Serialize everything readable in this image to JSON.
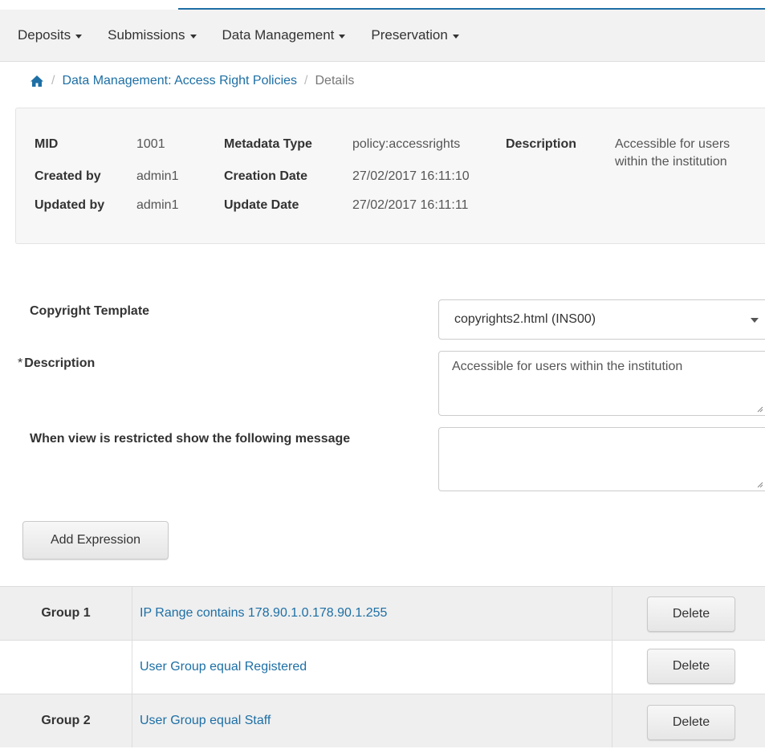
{
  "nav": {
    "items": [
      {
        "label": "Deposits"
      },
      {
        "label": "Submissions"
      },
      {
        "label": "Data Management"
      },
      {
        "label": "Preservation"
      }
    ]
  },
  "breadcrumb": {
    "home_icon": "home-icon",
    "separator": "/",
    "link": "Data Management: Access Right Policies",
    "current": "Details"
  },
  "info": {
    "mid_label": "MID",
    "mid_value": "1001",
    "metadata_type_label": "Metadata Type",
    "metadata_type_value": "policy:accessrights",
    "description_label": "Description",
    "description_value_line1": "Accessible for users",
    "description_value_line2": "within the institution",
    "created_by_label": "Created by",
    "created_by_value": "admin1",
    "creation_date_label": "Creation Date",
    "creation_date_value": "27/02/2017 16:11:10",
    "updated_by_label": "Updated by",
    "updated_by_value": "admin1",
    "update_date_label": "Update Date",
    "update_date_value": "27/02/2017 16:11:11"
  },
  "form": {
    "copyright_label": "Copyright Template",
    "copyright_value": "copyrights2.html (INS00)",
    "description_required": "*",
    "description_label": "Description",
    "description_value": "Accessible for users within the institution",
    "restricted_label": "When view is restricted show the following message",
    "restricted_value": "",
    "add_expression_label": "Add Expression"
  },
  "expressions": [
    {
      "group": "Group 1",
      "expression": "IP Range contains 178.90.1.0.178.90.1.255",
      "action": "Delete"
    },
    {
      "group": "",
      "expression": "User Group equal Registered",
      "action": "Delete"
    },
    {
      "group": "Group 2",
      "expression": "User Group equal Staff",
      "action": "Delete"
    }
  ],
  "colors": {
    "link": "#1d6fa5",
    "panel_bg": "#f7f7f7",
    "nav_bg": "#f2f2f2",
    "row_shade": "#efefef"
  }
}
